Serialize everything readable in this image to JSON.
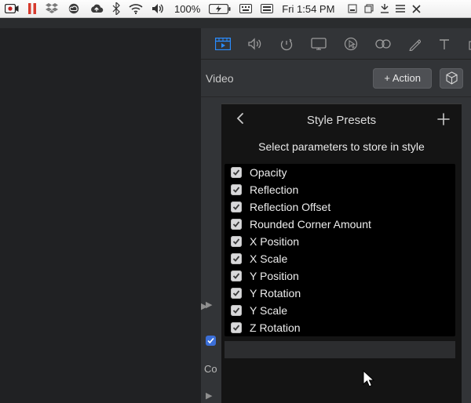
{
  "menubar": {
    "battery_text": "100%",
    "clock": "Fri 1:54 PM"
  },
  "panel": {
    "section_title": "Video",
    "action_button": "+ Action"
  },
  "popover": {
    "title": "Style Presets",
    "subtitle": "Select parameters to store in style",
    "params": [
      "Opacity",
      "Reflection",
      "Reflection Offset",
      "Rounded Corner Amount",
      "X Position",
      "X Scale",
      "Y Position",
      "Y Rotation",
      "Y Scale",
      "Z Rotation"
    ]
  },
  "sidebar": {
    "co_fragment": "Co"
  }
}
